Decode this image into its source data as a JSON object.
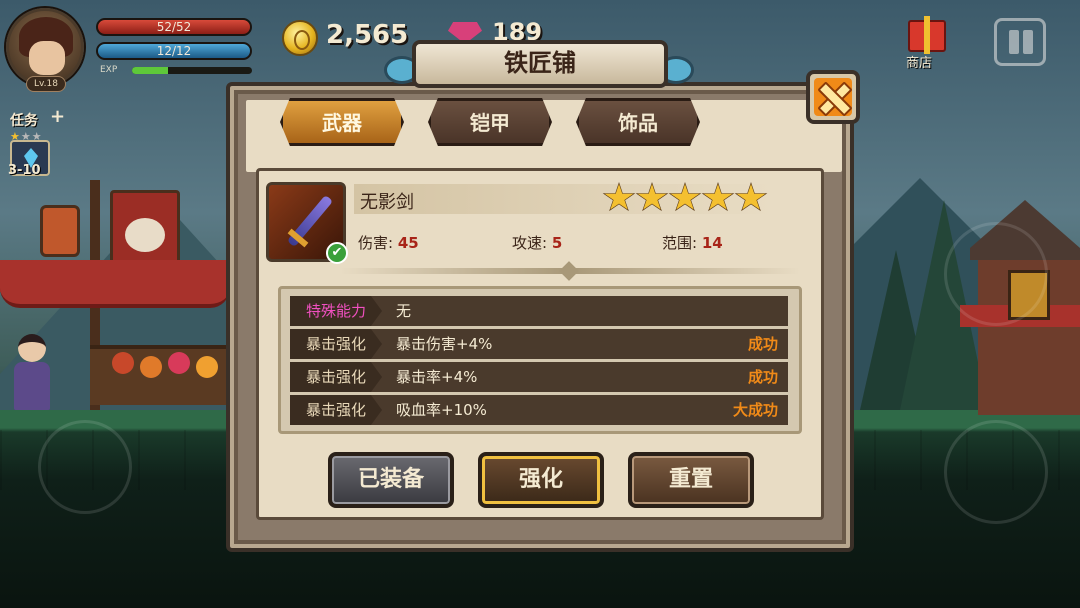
{
  "hud": {
    "hp_text": "52/52",
    "mp_text": "12/12",
    "exp_label": "EXP",
    "exp_fraction": 0.3,
    "level": "Lv.18",
    "coins": "2,565",
    "gems": "189",
    "task_label": "任务",
    "task_plus": "+",
    "task_stars_filled": 1,
    "task_stars_total": 3,
    "stage": "3-10",
    "shop_label": "商店"
  },
  "dialog": {
    "title": "铁匠铺",
    "tabs": [
      {
        "label": "武器",
        "active": true
      },
      {
        "label": "铠甲",
        "active": false
      },
      {
        "label": "饰品",
        "active": false
      }
    ],
    "item": {
      "name": "无影剑",
      "stars": 5,
      "stats": [
        {
          "label": "伤害:",
          "value": "45"
        },
        {
          "label": "攻速:",
          "value": "5"
        },
        {
          "label": "范围:",
          "value": "14"
        }
      ]
    },
    "abilities": [
      {
        "label": "特殊能力",
        "text": "无",
        "status": "",
        "special": true
      },
      {
        "label": "暴击强化",
        "text": "暴击伤害+4%",
        "status": "成功",
        "special": false
      },
      {
        "label": "暴击强化",
        "text": "暴击率+4%",
        "status": "成功",
        "special": false
      },
      {
        "label": "暴击强化",
        "text": "吸血率+10%",
        "status": "大成功",
        "special": false
      }
    ],
    "buttons": {
      "equipped": "已装备",
      "enhance": "强化",
      "reset": "重置"
    }
  },
  "colors": {
    "accent_gold": "#f0c040",
    "damage_value": "#a82418",
    "status_orange": "#f08a18",
    "special_pink": "#f050c0"
  }
}
